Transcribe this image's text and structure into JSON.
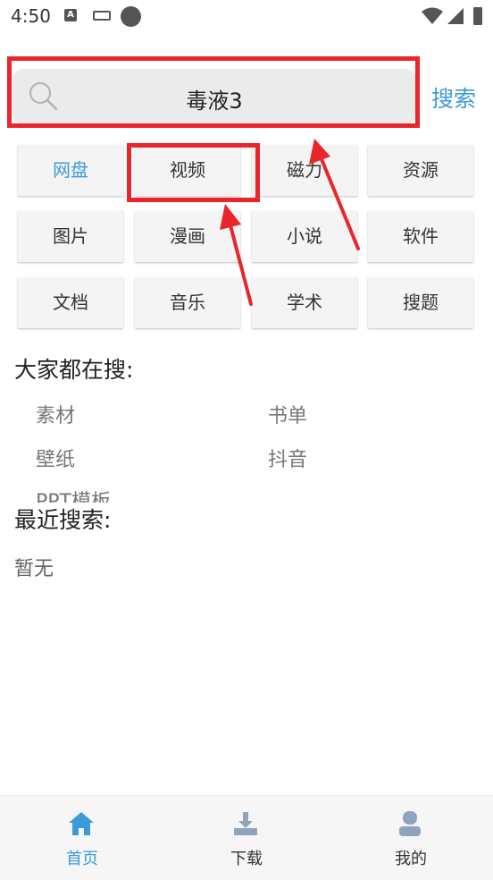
{
  "status_bar": {
    "time": "4:50",
    "notification_letter": "A"
  },
  "search": {
    "query": "毒液3",
    "button_label": "搜索"
  },
  "categories": [
    {
      "label": "网盘",
      "active": true
    },
    {
      "label": "视频",
      "active": false
    },
    {
      "label": "磁力",
      "active": false
    },
    {
      "label": "资源",
      "active": false
    },
    {
      "label": "图片",
      "active": false
    },
    {
      "label": "漫画",
      "active": false
    },
    {
      "label": "小说",
      "active": false
    },
    {
      "label": "软件",
      "active": false
    },
    {
      "label": "文档",
      "active": false
    },
    {
      "label": "音乐",
      "active": false
    },
    {
      "label": "学术",
      "active": false
    },
    {
      "label": "搜题",
      "active": false
    }
  ],
  "hot": {
    "title": "大家都在搜:",
    "items": [
      "素材",
      "书单",
      "壁纸",
      "抖音",
      "PPT模板"
    ]
  },
  "recent": {
    "title": "最近搜索:",
    "empty_text": "暂无"
  },
  "bottom_nav": [
    {
      "label": "首页",
      "icon": "home-icon",
      "active": true
    },
    {
      "label": "下载",
      "icon": "download-icon",
      "active": false
    },
    {
      "label": "我的",
      "icon": "profile-icon",
      "active": false
    }
  ],
  "colors": {
    "accent": "#3d9ad9",
    "annotation": "#e8262b"
  }
}
